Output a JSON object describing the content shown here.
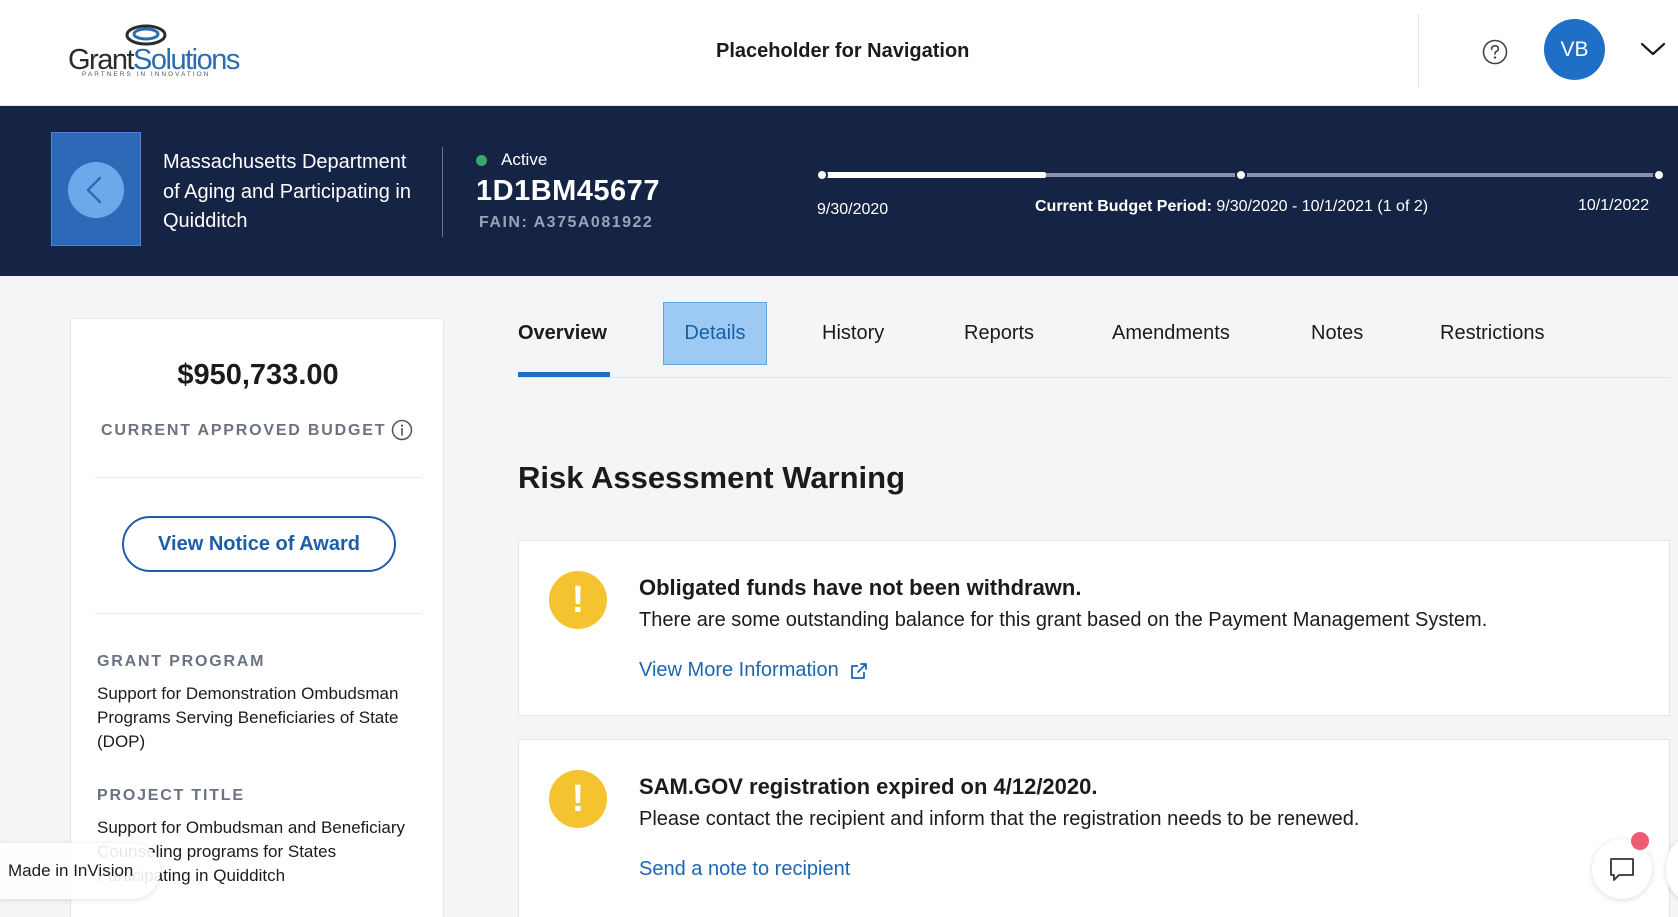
{
  "header": {
    "logo": {
      "word_main": "Grant",
      "word_accent": "Solutions",
      "tagline": "PARTNERS IN INNOVATION"
    },
    "nav_placeholder": "Placeholder for Navigation",
    "help_icon": "question-circle-icon",
    "avatar_initials": "VB",
    "menu_icon": "chevron-down-icon"
  },
  "banner": {
    "back_icon": "chevron-left-icon",
    "org_name": "Massachusetts Department of Aging and Participating in Quidditch",
    "status": "Active",
    "status_color": "#3aa76d",
    "grant_id": "1D1BM45677",
    "fain": "FAIN: A375A081922",
    "timeline": {
      "start_date": "9/30/2020",
      "end_date": "10/1/2022",
      "current_label": "Current Budget Period:",
      "current_value": "9/30/2020 - 10/1/2021 (1 of 2)"
    }
  },
  "sidebar": {
    "budget_amount": "$950,733.00",
    "budget_label": "CURRENT APPROVED BUDGET",
    "info_icon": "info-circle-icon",
    "noa_button": "View Notice of Award",
    "grant_program_label": "GRANT PROGRAM",
    "grant_program_value": "Support for Demonstration Ombudsman Programs Serving Beneficiaries of State (DOP)",
    "project_title_label": "PROJECT TITLE",
    "project_title_value": "Support for Ombudsman and Beneficiary Counseling programs for States Participating in Quidditch"
  },
  "tabs": [
    {
      "label": "Overview",
      "active": true
    },
    {
      "label": "Details",
      "highlighted": true
    },
    {
      "label": "History"
    },
    {
      "label": "Reports"
    },
    {
      "label": "Amendments"
    },
    {
      "label": "Notes"
    },
    {
      "label": "Restrictions"
    }
  ],
  "main": {
    "section_title": "Risk Assessment Warning",
    "warnings": [
      {
        "icon": "exclamation-icon",
        "title": "Obligated funds have not been withdrawn.",
        "description": "There are some outstanding balance for this grant based on the Payment Management System.",
        "link": "View More Information",
        "link_icon": "external-link-icon"
      },
      {
        "icon": "exclamation-icon",
        "title": "SAM.GOV registration expired on 4/12/2020.",
        "description": "Please contact the recipient and inform that the registration needs to be renewed.",
        "link": "Send a note to recipient"
      }
    ]
  },
  "overlay": {
    "invision_badge": "Made in InVision",
    "chat_icon": "chat-bubble-icon"
  },
  "colors": {
    "banner_bg": "#152345",
    "accent_blue": "#1e6fc5",
    "warning_yellow": "#f5c230",
    "link_blue": "#1d66b4"
  }
}
